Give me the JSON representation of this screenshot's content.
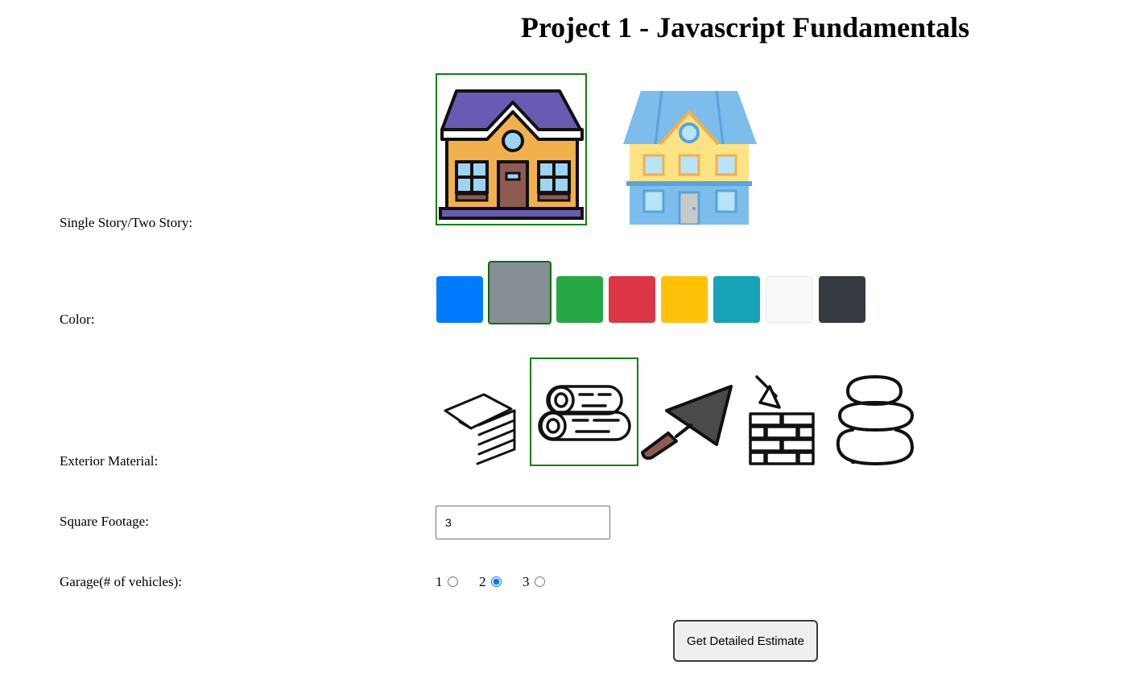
{
  "page": {
    "title": "Project 1 - Javascript Fundamentals"
  },
  "story": {
    "label": "Single Story/Two Story:",
    "options": [
      {
        "name": "single-story",
        "icon": "single-story-house-icon",
        "selected": true
      },
      {
        "name": "two-story",
        "icon": "two-story-house-icon",
        "selected": false
      }
    ]
  },
  "color": {
    "label": "Color:",
    "swatches": [
      {
        "name": "blue",
        "hex": "#007bff",
        "selected": false
      },
      {
        "name": "gray",
        "hex": "#868e96",
        "selected": true
      },
      {
        "name": "green",
        "hex": "#28a745",
        "selected": false
      },
      {
        "name": "red",
        "hex": "#dc3545",
        "selected": false
      },
      {
        "name": "yellow",
        "hex": "#ffc107",
        "selected": false
      },
      {
        "name": "teal",
        "hex": "#17a2b8",
        "selected": false
      },
      {
        "name": "light",
        "hex": "#f8f9fa",
        "selected": false
      },
      {
        "name": "dark",
        "hex": "#343a40",
        "selected": false
      }
    ]
  },
  "material": {
    "label": "Exterior Material:",
    "options": [
      {
        "name": "siding",
        "icon": "siding-icon",
        "selected": false
      },
      {
        "name": "wood-logs",
        "icon": "wood-logs-icon",
        "selected": true
      },
      {
        "name": "stucco-trowel",
        "icon": "trowel-icon",
        "selected": false
      },
      {
        "name": "brick",
        "icon": "brick-wall-icon",
        "selected": false
      },
      {
        "name": "stone",
        "icon": "stacked-stones-icon",
        "selected": false
      }
    ]
  },
  "footage": {
    "label": "Square Footage:",
    "value": "3"
  },
  "garage": {
    "label": "Garage(# of vehicles):",
    "options": [
      {
        "label": "1",
        "checked": false
      },
      {
        "label": "2",
        "checked": true
      },
      {
        "label": "3",
        "checked": false
      }
    ]
  },
  "estimate": {
    "button_label": "Get Detailed Estimate"
  },
  "colors": {
    "selection_border": "#118011"
  }
}
